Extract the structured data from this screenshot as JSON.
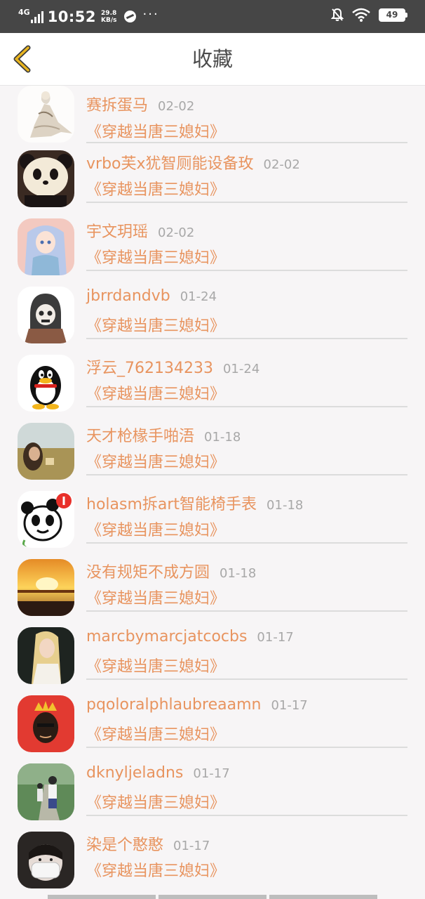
{
  "status_bar": {
    "network": "4G",
    "time": "10:52",
    "speed_value": "29.8",
    "speed_unit": "KB/s",
    "more": "···",
    "battery": "49"
  },
  "header": {
    "title": "收藏",
    "back_icon": "chevron-left-icon"
  },
  "favorites": [
    {
      "name": "赛拆蛋马",
      "date": "02-02",
      "book": "《穿越当唐三媳妇》",
      "avatar": "bird-illustration"
    },
    {
      "name": "vrbo芙x犹智厕能设备玫",
      "date": "02-02",
      "book": "《穿越当唐三媳妇》",
      "avatar": "panda-bear"
    },
    {
      "name": "宇文玥瑶",
      "date": "02-02",
      "book": "《穿越当唐三媳妇》",
      "avatar": "anime-girl"
    },
    {
      "name": "jbrrdandvb",
      "date": "01-24",
      "book": "《穿越当唐三媳妇》",
      "avatar": "hooded-skull"
    },
    {
      "name": "浮云_762134233",
      "date": "01-24",
      "book": "《穿越当唐三媳妇》",
      "avatar": "qq-penguin"
    },
    {
      "name": "天才枪椽手啪浯",
      "date": "01-18",
      "book": "《穿越当唐三媳妇》",
      "avatar": "field-photo"
    },
    {
      "name": "holasm拆art智能椅手表",
      "date": "01-18",
      "book": "《穿越当唐三媳妇》",
      "avatar": "cartoon-panda"
    },
    {
      "name": "没有规矩不成方圆",
      "date": "01-18",
      "book": "《穿越当唐三媳妇》",
      "avatar": "sunset"
    },
    {
      "name": "marcbymarcjatcocbs",
      "date": "01-17",
      "book": "《穿越当唐三媳妇》",
      "avatar": "blonde-woman"
    },
    {
      "name": "pqoloralphlaubreaamn",
      "date": "01-17",
      "book": "《穿越当唐三媳妇》",
      "avatar": "crowned-face"
    },
    {
      "name": "dknyljeladns",
      "date": "01-17",
      "book": "《穿越当唐三媳妇》",
      "avatar": "students-path"
    },
    {
      "name": "染是个憨憨",
      "date": "01-17",
      "book": "《穿越当唐三媳妇》",
      "avatar": "masked-face"
    }
  ],
  "colors": {
    "status_bar": "#464646",
    "accent": "#e8945f",
    "back_arrow": "#e9b520",
    "date": "#a8a8a8",
    "title": "#4b4b4b"
  }
}
